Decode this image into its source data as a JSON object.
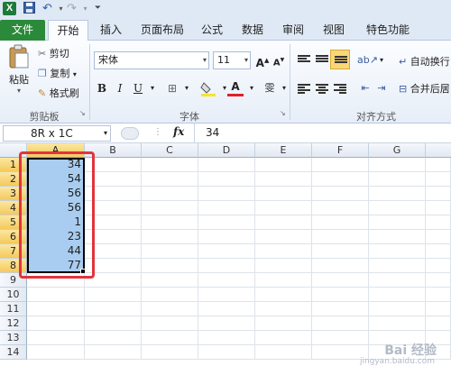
{
  "quick_access": {
    "logo_letter": "X",
    "save_icon": "save-icon",
    "undo_icon": "undo-icon",
    "redo_icon": "redo-icon",
    "customize_icon": "customize-icon"
  },
  "tabs": [
    {
      "label": "文件",
      "active": false
    },
    {
      "label": "开始",
      "active": true
    },
    {
      "label": "插入"
    },
    {
      "label": "页面布局"
    },
    {
      "label": "公式"
    },
    {
      "label": "数据"
    },
    {
      "label": "审阅"
    },
    {
      "label": "视图"
    },
    {
      "label": "特色功能"
    }
  ],
  "ribbon": {
    "clipboard": {
      "paste_label": "粘贴",
      "cut_label": "剪切",
      "copy_label": "复制",
      "format_painter_label": "格式刷",
      "group_label": "剪贴板"
    },
    "font": {
      "font_name": "宋体",
      "font_size": "11",
      "grow_label": "A",
      "shrink_label": "A",
      "bold_label": "B",
      "italic_label": "I",
      "underline_label": "U",
      "color_label": "A",
      "wen_label": "雯",
      "group_label": "字体"
    },
    "alignment": {
      "wrap_text_label": "自动换行",
      "merge_label": "合并后居",
      "group_label": "对齐方式"
    }
  },
  "formula_bar": {
    "name_box": "8R x 1C",
    "fx_label": "fx",
    "value": "34"
  },
  "columns": [
    "A",
    "B",
    "C",
    "D",
    "E",
    "F",
    "G"
  ],
  "rows": [
    "1",
    "2",
    "3",
    "4",
    "5",
    "6",
    "7",
    "8",
    "9",
    "10",
    "11",
    "12",
    "13",
    "14"
  ],
  "column_a_values": [
    "34",
    "54",
    "56",
    "56",
    "1",
    "23",
    "44",
    "77"
  ],
  "selection": {
    "range": "A1:A8",
    "highlight_color": "#e0353b"
  },
  "watermark": {
    "text": "Bai 经验",
    "url": "jingyan.baidu.com"
  }
}
